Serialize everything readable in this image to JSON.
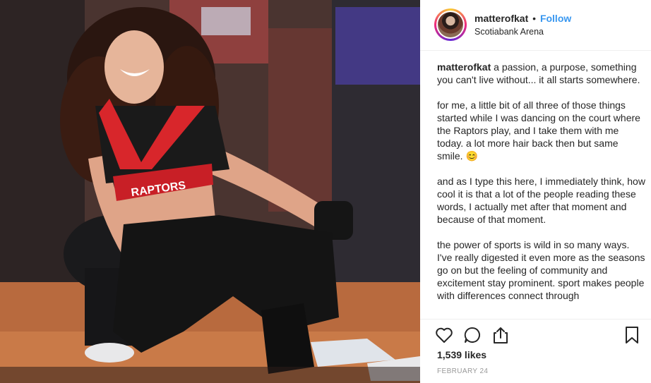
{
  "post": {
    "photo_alt": "post-photo",
    "jersey_text": "RAPTORS"
  },
  "header": {
    "username": "matterofkat",
    "separator": "•",
    "follow_label": "Follow",
    "location": "Scotiabank Arena"
  },
  "caption": {
    "username": "matterofkat",
    "paragraphs": [
      " a passion, a purpose, something you can't live without... it all starts somewhere.",
      "for me, a little bit of all three of those things started while I was dancing on the court where the Raptors play, and I take them with me today. a lot more hair back then but same smile. 😊",
      "and as I type this here, I immediately think, how cool it is that a lot of the people reading these words, I actually met after that moment and because of that moment.",
      "the power of sports is wild in so many ways. I've really digested it even more as the seasons go on but the feeling of community and excitement stay prominent. sport makes people with differences connect through"
    ]
  },
  "actions": {
    "likes": "1,539 likes",
    "date": "FEBRUARY 24",
    "icons": [
      "heart-icon",
      "comment-icon",
      "share-icon",
      "bookmark-icon"
    ]
  },
  "colors": {
    "accent": "#3897f0",
    "text": "#262626",
    "muted": "#999999"
  }
}
